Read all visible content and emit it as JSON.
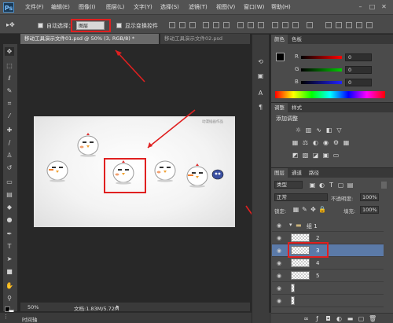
{
  "app": {
    "logo": "Ps"
  },
  "menu": [
    "文件(F)",
    "编辑(E)",
    "图像(I)",
    "图层(L)",
    "文字(Y)",
    "选择(S)",
    "滤镜(T)",
    "视图(V)",
    "窗口(W)",
    "帮助(H)"
  ],
  "window_controls": {
    "minimize": "–",
    "restore": "□",
    "close": "✕"
  },
  "options": {
    "auto_select_label": "自动选择：",
    "auto_select_value": "图层",
    "show_transform_label": "显示变换控件"
  },
  "documents": {
    "active_tab": "移动工具演示文件01.psd @ 50% (3, RGB/8) *",
    "inactive_tab": "移动工具演示文件02.psd"
  },
  "status": {
    "zoom": "50%",
    "doc_info": "文档:1.83M/5.72M",
    "timeline": "时间轴"
  },
  "image": {
    "caption": "动漫插画作品"
  },
  "color_panel": {
    "tabs": [
      "颜色",
      "色板"
    ],
    "channels": [
      {
        "label": "R",
        "value": "0"
      },
      {
        "label": "G",
        "value": "0"
      },
      {
        "label": "B",
        "value": "0"
      }
    ]
  },
  "adjust_panel": {
    "tabs": [
      "调整",
      "样式"
    ],
    "title": "添加调整"
  },
  "layers_panel": {
    "tabs": [
      "图层",
      "通道",
      "路径"
    ],
    "filter_label": "类型",
    "blend_mode": "正常",
    "opacity_label": "不透明度:",
    "opacity_value": "100%",
    "lock_label": "锁定:",
    "fill_label": "填充:",
    "fill_value": "100%",
    "layers": [
      {
        "name": "组 1",
        "kind": "group"
      },
      {
        "name": "2",
        "kind": "layer"
      },
      {
        "name": "3",
        "kind": "layer",
        "selected": true
      },
      {
        "name": "4",
        "kind": "layer"
      },
      {
        "name": "5",
        "kind": "layer"
      },
      {
        "name": "",
        "kind": "layer"
      },
      {
        "name": "",
        "kind": "layer"
      }
    ]
  },
  "colors": {
    "annotation_red": "#e02020",
    "selection_blue": "#5b7aa8",
    "panel_bg": "#4b4b4b"
  }
}
